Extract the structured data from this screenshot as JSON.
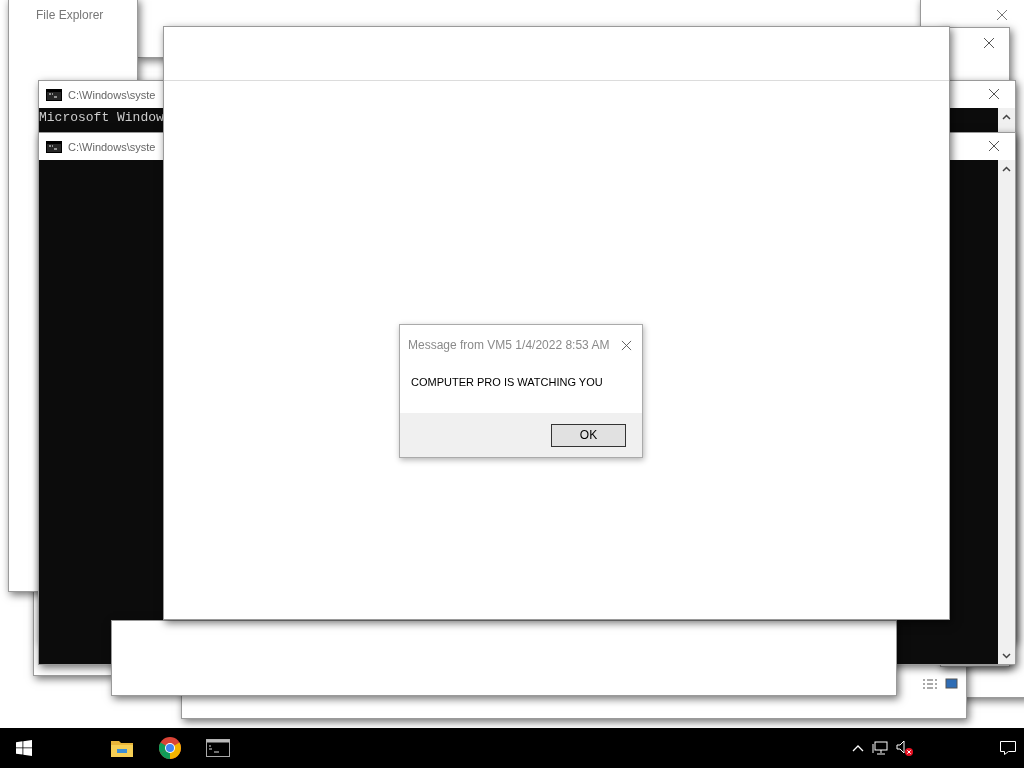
{
  "windows": [
    {
      "kind": "explorer",
      "title": "File Explorer"
    },
    {
      "kind": "console",
      "title": "C:\\Windows\\syste",
      "lines": [
        "Microsoft Window"
      ]
    },
    {
      "kind": "console",
      "title": "C:\\Windows\\syste"
    }
  ],
  "dialog": {
    "title": "Message from VM5 1/4/2022 8:53 AM",
    "message": "COMPUTER PRO IS WATCHING YOU",
    "button": "OK"
  },
  "taskbar": {
    "apps": [
      {
        "kind": "explorer"
      },
      {
        "kind": "chrome"
      },
      {
        "kind": "console"
      }
    ],
    "speaker_muted": true
  }
}
